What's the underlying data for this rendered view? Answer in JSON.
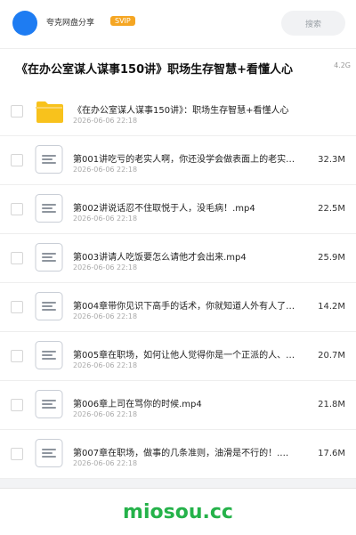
{
  "header": {
    "app_name": "夸克网盘分享",
    "vip_badge": "SVIP",
    "search_label": "搜索"
  },
  "title_bar": {
    "title": "《在办公室谋人谋事150讲》职场生存智慧+看懂人心",
    "total_size": "4.2G"
  },
  "files": [
    {
      "name": "《在办公室谋人谋事150讲》：职场生存智慧+看懂人心",
      "date": "2026-06-06 22:18",
      "size": "",
      "type": "folder"
    },
    {
      "name": "第001讲吃亏的老实人啊，你还没学会做表面上的老实…",
      "date": "2026-06-06 22:18",
      "size": "32.3M",
      "type": "video"
    },
    {
      "name": "第002讲说话忍不住取悦于人，没毛病！.mp4",
      "date": "2026-06-06 22:18",
      "size": "22.5M",
      "type": "video"
    },
    {
      "name": "第003讲请人吃饭要怎么请他才会出来.mp4",
      "date": "2026-06-06 22:18",
      "size": "25.9M",
      "type": "video"
    },
    {
      "name": "第004章带你见识下高手的话术，你就知道人外有人了…",
      "date": "2026-06-06 22:18",
      "size": "14.2M",
      "type": "video"
    },
    {
      "name": "第005章在职场，如何让他人觉得你是一个正派的人、…",
      "date": "2026-06-06 22:18",
      "size": "20.7M",
      "type": "video"
    },
    {
      "name": "第006章上司在骂你的时候.mp4",
      "date": "2026-06-06 22:18",
      "size": "21.8M",
      "type": "video"
    },
    {
      "name": "第007章在职场，做事的几条准则，油滑是不行的！.…",
      "date": "2026-06-06 22:18",
      "size": "17.6M",
      "type": "video"
    }
  ],
  "footer": {
    "watermark": "miosou.cc"
  },
  "colors": {
    "accent": "#1e7cf2",
    "vip": "#f5a623",
    "folder": "#f8c21c",
    "watermark": "#25b24a"
  }
}
